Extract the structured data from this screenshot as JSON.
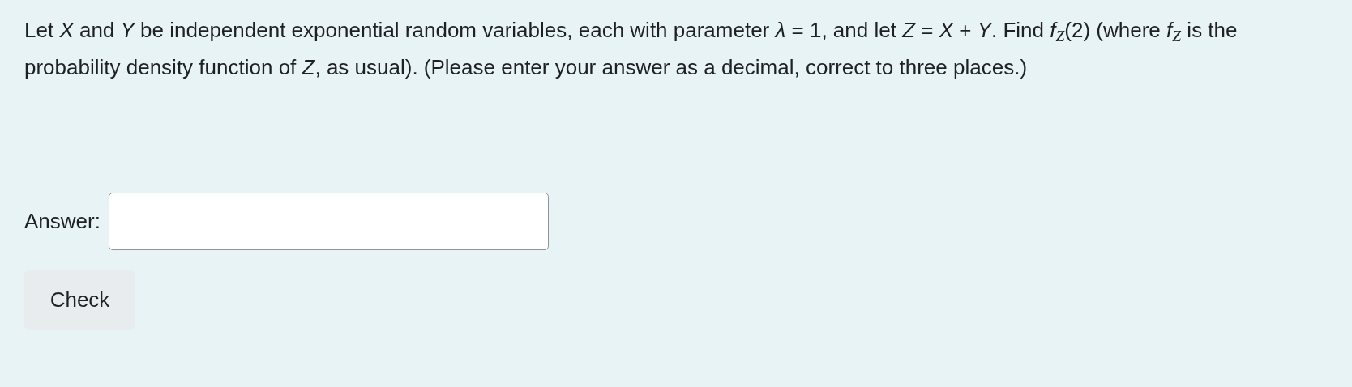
{
  "question": "Let *X* and *Y* be independent exponential random variables, each with parameter *λ* = 1, and let *Z* = *X* + *Y*. Find *f*$_{Z}$(2) (where *f*$_{Z}$ is the probability density function of *Z*, as usual). (Please enter your answer as a decimal, correct to three places.)",
  "answer": {
    "label": "Answer:"
  },
  "check_button": "Check"
}
